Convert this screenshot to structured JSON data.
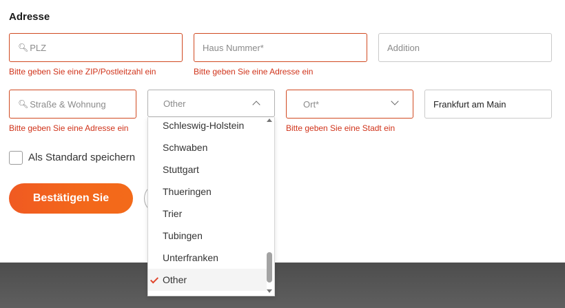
{
  "section_title": "Adresse",
  "fields": {
    "zip": {
      "placeholder": "PLZ",
      "error": "Bitte geben Sie eine ZIP/Postleitzahl ein"
    },
    "house_number": {
      "placeholder": "Haus Nummer*",
      "error": "Bitte geben Sie eine Adresse ein"
    },
    "addition": {
      "placeholder": "Addition"
    },
    "street": {
      "placeholder": "Straße & Wohnung",
      "error": "Bitte geben Sie eine Adresse ein"
    },
    "region": {
      "value": "Other"
    },
    "city": {
      "placeholder": "Ort*",
      "error": "Bitte geben Sie eine Stadt ein"
    },
    "city_name": {
      "value": "Frankfurt am Main"
    }
  },
  "dropdown": {
    "options": [
      "Schleswig-Holstein",
      "Schwaben",
      "Stuttgart",
      "Thueringen",
      "Trier",
      "Tubingen",
      "Unterfranken",
      "Other"
    ],
    "selected": "Other"
  },
  "save_default_label": "Als Standard speichern",
  "confirm_button": "Bestätigen Sie",
  "colors": {
    "accent": "#f05a22",
    "error": "#d0331a",
    "footer": "#555555"
  },
  "icons": {
    "search": "search-icon",
    "chevron_up": "chevron-up-icon",
    "chevron_down": "chevron-down-icon",
    "check": "check-icon"
  }
}
